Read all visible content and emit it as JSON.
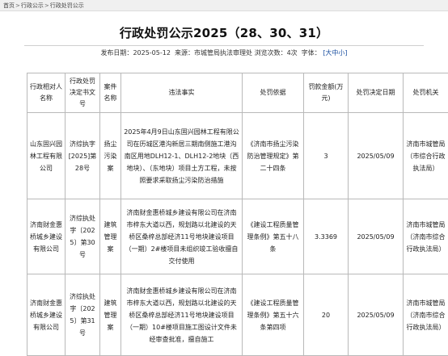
{
  "breadcrumb": [
    "首页",
    "行政公示",
    "行政处罚公示"
  ],
  "page_title": "行政处罚公示2025（28、30、31）",
  "meta": {
    "publish_label": "发布日期：",
    "publish_date": "2025-05-12",
    "source_label": "来源：",
    "source": "市城管局执法审理处",
    "views_label": "浏览次数：",
    "views": "4次",
    "font_label": "字体：",
    "font_switch": "[大中小]"
  },
  "table": {
    "headers": [
      "行政相对人名称",
      "行政处罚决定书文号",
      "案件名称",
      "违法事实",
      "处罚依据",
      "罚款金额(万元)",
      "处罚决定日期",
      "处罚机关"
    ],
    "rows": [
      {
        "party": "山东固兴园林工程有限公司",
        "doc_no": "济综执字[2025]第28号",
        "case_name": "扬尘污染案",
        "facts": "2025年4月9日山东固兴园林工程有限公司在历城区港沟新居三期南侧施工港沟南区用地DLH12-1、DLH12-2地块（西地块）、（东地块）项目土方工程，未按照要求采取扬尘污染防治措施",
        "basis": "《济南市扬尘污染防治管理规定》第二十四条",
        "fine": "3",
        "date": "2025/05/09",
        "authority": "济南市城管局（市综合行政执法局）"
      },
      {
        "party": "济南财金惠桥城乡建设有限公司",
        "doc_no": "济综执处字〔2025〕第30号",
        "case_name": "建筑管理案",
        "facts": "济南财金惠桥城乡建设有限公司在济南市梓东大道以西，规划路以北建设的天桥区桑梓总部经济11号地块建设项目（一期）2#楼项目未组织竣工验收擅自交付使用",
        "basis": "《建设工程质量管理条例》第五十八条",
        "fine": "3.3369",
        "date": "2025/05/09",
        "authority": "济南市城管局（济南市综合行政执法局）"
      },
      {
        "party": "济南财金惠桥城乡建设有限公司",
        "doc_no": "济综执处字〔2025〕第31号",
        "case_name": "建筑管理案",
        "facts": "济南财金惠桥城乡建设有限公司在济南市梓东大道以西，规划路以北建设的天桥区桑梓总部经济11号地块建设项目（一期）10#楼项目施工图设计文件未经审查批准，擅自施工",
        "basis": "《建设工程质量管理条例》第五十六条第四项",
        "fine": "20",
        "date": "2025/05/09",
        "authority": "济南市城管局（济南市综合行政执法局）"
      }
    ]
  }
}
